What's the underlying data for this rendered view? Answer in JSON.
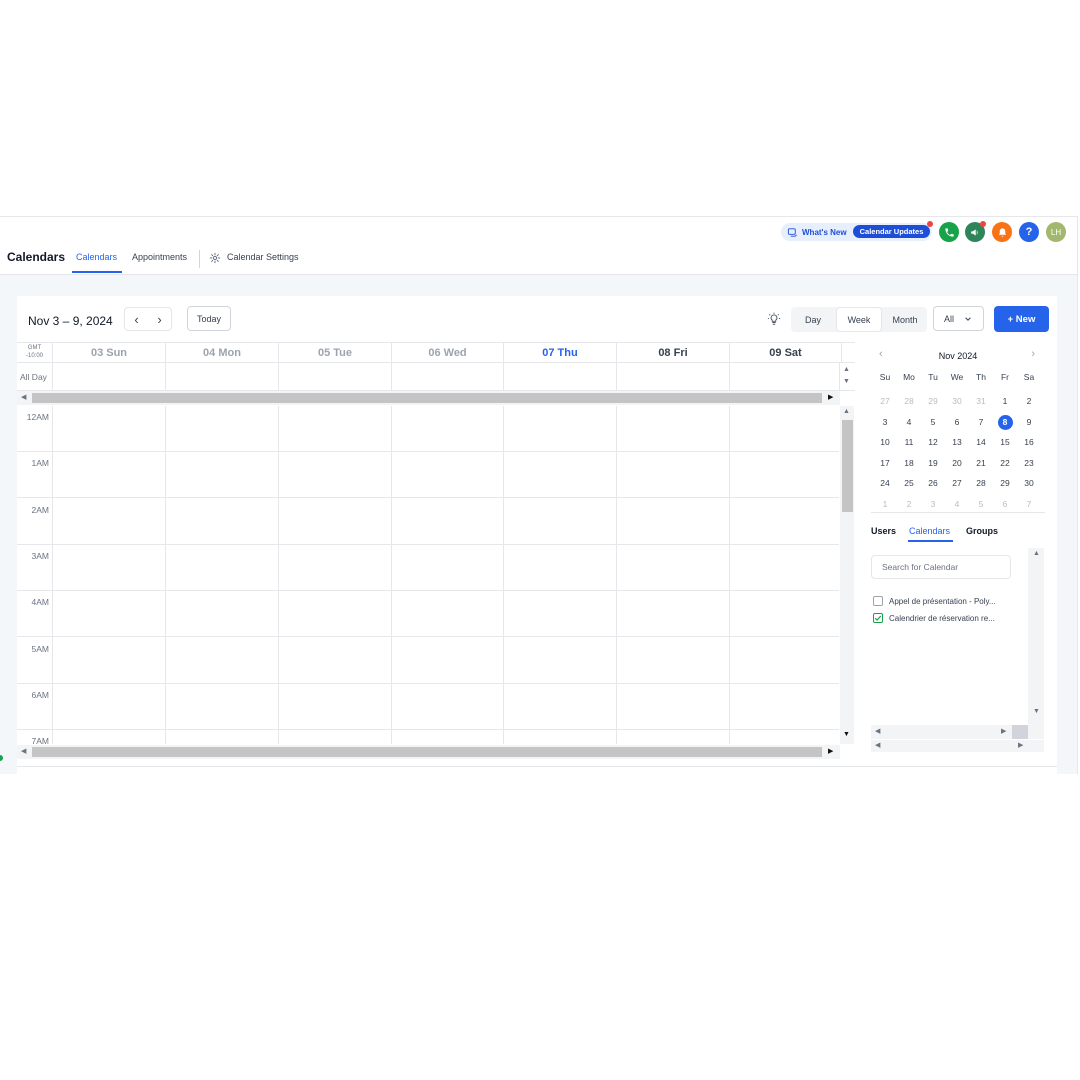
{
  "header": {
    "title": "Calendars",
    "tabs": [
      {
        "label": "Calendars",
        "active": true
      },
      {
        "label": "Appointments",
        "active": false
      }
    ],
    "settings_label": "Calendar Settings",
    "whats_new": "What's New",
    "calendar_updates": "Calendar Updates",
    "avatar_initials": "LH",
    "help_symbol": "?"
  },
  "toolbar": {
    "date_range": "Nov 3 – 9, 2024",
    "prev_icon": "‹",
    "next_icon": "›",
    "today_label": "Today",
    "views": [
      "Day",
      "Week",
      "Month"
    ],
    "active_view": "Week",
    "filter_value": "All",
    "new_label": "+ New"
  },
  "week": {
    "timezone_line1": "GMT",
    "timezone_line2": "-10:00",
    "all_day_label": "All Day",
    "days": [
      {
        "label": "03 Sun"
      },
      {
        "label": "04 Mon"
      },
      {
        "label": "05 Tue"
      },
      {
        "label": "06 Wed"
      },
      {
        "label": "07 Thu",
        "today": true
      },
      {
        "label": "08 Fri",
        "selected": true
      },
      {
        "label": "09 Sat",
        "selected": true
      }
    ],
    "hours": [
      "12AM",
      "1AM",
      "2AM",
      "3AM",
      "4AM",
      "5AM",
      "6AM",
      "7AM"
    ]
  },
  "mini_calendar": {
    "title": "Nov 2024",
    "weekdays": [
      "Su",
      "Mo",
      "Tu",
      "We",
      "Th",
      "Fr",
      "Sa"
    ],
    "weeks": [
      [
        "27",
        "28",
        "29",
        "30",
        "31",
        "1",
        "2"
      ],
      [
        "3",
        "4",
        "5",
        "6",
        "7",
        "8",
        "9"
      ],
      [
        "10",
        "11",
        "12",
        "13",
        "14",
        "15",
        "16"
      ],
      [
        "17",
        "18",
        "19",
        "20",
        "21",
        "22",
        "23"
      ],
      [
        "24",
        "25",
        "26",
        "27",
        "28",
        "29",
        "30"
      ],
      [
        "1",
        "2",
        "3",
        "4",
        "5",
        "6",
        "7"
      ]
    ],
    "selected_day": "8"
  },
  "sidebar": {
    "tabs": [
      {
        "label": "Users",
        "active": false
      },
      {
        "label": "Calendars",
        "active": true
      },
      {
        "label": "Groups",
        "active": false
      }
    ],
    "search_placeholder": "Search for Calendar",
    "calendars": [
      {
        "label": "Appel de présentation - Poly...",
        "checked": false
      },
      {
        "label": "Calendrier de réservation re...",
        "checked": true
      }
    ]
  },
  "colors": {
    "accent": "#2563eb",
    "phone_icon": "#16a34a",
    "megaphone_icon": "#2f855a",
    "bell_icon": "#f97316",
    "help_icon": "#2563eb",
    "avatar": "#a3b86c",
    "check": "#16a34a"
  }
}
